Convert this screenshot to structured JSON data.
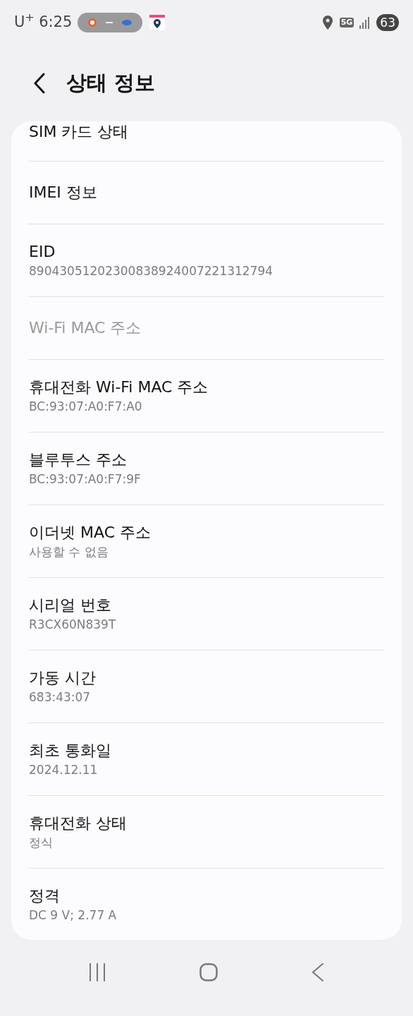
{
  "status_bar": {
    "carrier_time": "U$^{+}$ 6:25",
    "network": "5G",
    "battery": "63"
  },
  "header": {
    "title": "상태 정보"
  },
  "items": [
    {
      "title": "SIM 카드 상태",
      "disabled": false
    },
    {
      "title": "IMEI 정보",
      "disabled": false
    },
    {
      "title": "EID",
      "value": "89043051202300838924007221312794",
      "disabled": false
    },
    {
      "title": "Wi-Fi MAC 주소",
      "disabled": true
    },
    {
      "title": "휴대전화 Wi-Fi MAC 주소",
      "value": "BC:93:07:A0:F7:A0",
      "disabled": false
    },
    {
      "title": "블루투스 주소",
      "value": "BC:93:07:A0:F7:9F",
      "disabled": false
    },
    {
      "title": "이더넷 MAC 주소",
      "value": "사용할 수 없음",
      "disabled": false
    },
    {
      "title": "시리얼 번호",
      "value": "R3CX60N839T",
      "disabled": false
    },
    {
      "title": "가동 시간",
      "value": "683:43:07",
      "disabled": false
    },
    {
      "title": "최초 통화일",
      "value": "2024.12.11",
      "disabled": false
    },
    {
      "title": "휴대전화 상태",
      "value": "정식",
      "disabled": false
    },
    {
      "title": "정격",
      "value": "DC 9 V; 2.77 A",
      "disabled": false
    }
  ]
}
